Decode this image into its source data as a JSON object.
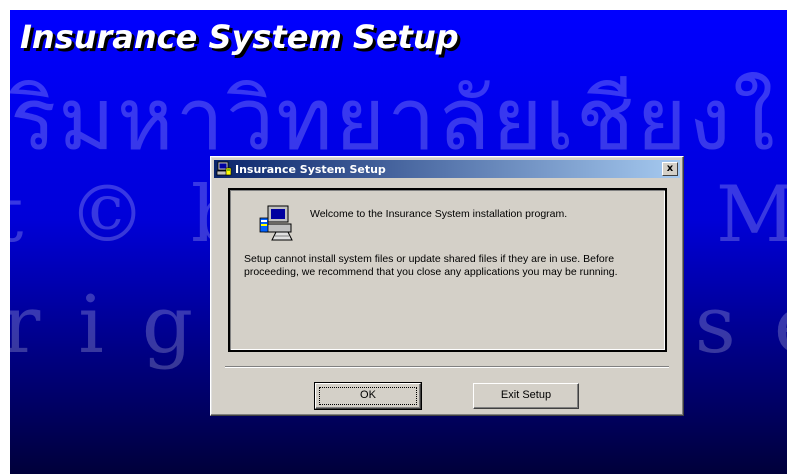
{
  "screen": {
    "setup_title": "Insurance System Setup",
    "background_color_top": "#0000ff",
    "background_color_bottom": "#00003a"
  },
  "watermark": {
    "line1": "ริมหาวิทยาลัยเชียงใ",
    "line2": "t © by Chiang Mai Univ",
    "line3": "rights reserv"
  },
  "dialog": {
    "title": "Insurance System Setup",
    "close_label": "x",
    "welcome": "Welcome to the Insurance System installation program.",
    "warning": "Setup cannot install system files or update shared files if they are in use. Before proceeding, we recommend that you close any applications you may be running.",
    "ok_label": "OK",
    "exit_label": "Exit Setup",
    "titlebar_color": "#0a246a",
    "face_color": "#d4d0c8"
  },
  "icons": {
    "title": "setup-computer-icon",
    "content": "setup-computer-icon"
  }
}
